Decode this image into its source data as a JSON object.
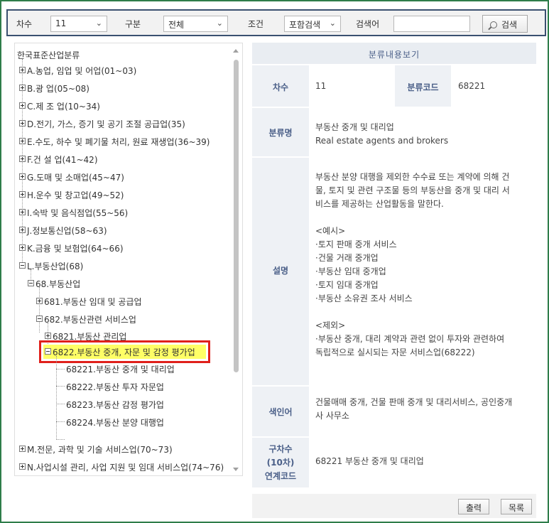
{
  "search": {
    "chasu_label": "차수",
    "chasu_value": "11",
    "gubun_label": "구분",
    "gubun_value": "전체",
    "condition_label": "조건",
    "condition_value": "포함검색",
    "keyword_label": "검색어",
    "keyword_value": "",
    "search_button": "검색"
  },
  "tree": {
    "root": "한국표준산업분류",
    "sections": [
      "A.농업, 임업 및 어업(01~03)",
      "B.광 업(05~08)",
      "C.제 조 업(10~34)",
      "D.전기, 가스, 증기 및 공기 조절 공급업(35)",
      "E.수도, 하수 및 폐기물 처리, 원료 재생업(36~39)",
      "F.건 설 업(41~42)",
      "G.도매 및 소매업(45~47)",
      "H.운수 및 창고업(49~52)",
      "I.숙박 및 음식점업(55~56)",
      "J.정보통신업(58~63)",
      "K.금융 및 보험업(64~66)",
      "L.부동산업(68)"
    ],
    "division": "68.부동산업",
    "groups": [
      "681.부동산 임대 및 공급업",
      "682.부동산관련 서비스업"
    ],
    "classes": [
      "6821.부동산 관리업",
      "6822.부동산 중개, 자문 및 감정 평가업"
    ],
    "subclasses": [
      "68221.부동산 중개 및 대리업",
      "68222.부동산 투자 자문업",
      "68223.부동산 감정 평가업",
      "68224.부동산 분양 대행업"
    ],
    "bottom_sections": [
      "M.전문, 과학 및 기술 서비스업(70~73)",
      "N.사업시설 관리, 사업 지원 및 임대 서비스업(74~76)"
    ]
  },
  "detail": {
    "title": "분류내용보기",
    "chasu_label": "차수",
    "chasu_value": "11",
    "code_label": "분류코드",
    "code_value": "68221",
    "name_label": "분류명",
    "name_ko": "부동산 중개 및 대리업",
    "name_en": "Real estate agents and brokers",
    "desc_label": "설명",
    "desc_lines": [
      "부동산 분양 대행을 제외한 수수료 또는 계약에 의해 건",
      "물, 토지 및 관련 구조물 등의 부동산을 중개 및 대리 서",
      "비스를 제공하는 산업활동을 말한다.",
      "",
      "<예시>",
      "·토지 판매 중개 서비스",
      "·건물 거래 중개업",
      "·부동산 임대 중개업",
      "·토지 임대 중개업",
      "·부동산 소유권 조사 서비스",
      "",
      "<제외>",
      "·부동산 중개, 대리 계약과 관련 없이 투자와 관련하여",
      "독립적으로 실시되는 자문 서비스업(68222)"
    ],
    "index_label": "색인어",
    "index_lines": [
      "건물매매 중개, 건물 판매 중개 및 대리서비스, 공인중개",
      "사 사무소"
    ],
    "oldcode_label_lines": [
      "구차수",
      "(10차)",
      "연계코드"
    ],
    "oldcode_value": "68221 부동산 중개 및 대리업",
    "print_button": "출력",
    "list_button": "목록"
  }
}
